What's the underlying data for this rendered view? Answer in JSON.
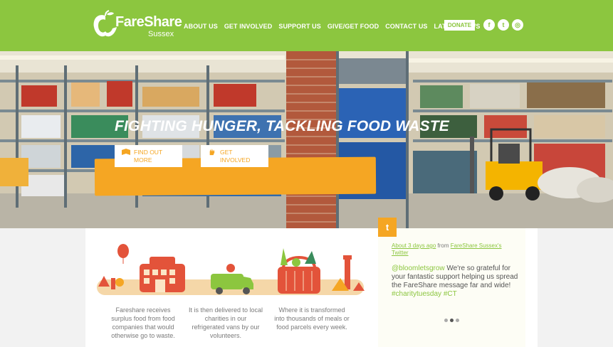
{
  "brand": {
    "name": "FareShare",
    "subname": "Sussex"
  },
  "nav": {
    "items": [
      "ABOUT US",
      "GET INVOLVED",
      "SUPPORT US",
      "GIVE/GET FOOD",
      "CONTACT US",
      "LATEST NEWS"
    ],
    "donate": "DONATE"
  },
  "social": {
    "facebook": "f",
    "twitter": "t",
    "instagram": "◎"
  },
  "hero": {
    "headline": "FIGHTING HUNGER, TACKLING FOOD WASTE",
    "buttons": [
      {
        "label": "FIND OUT MORE",
        "icon": "book-icon"
      },
      {
        "label": "GET INVOLVED",
        "icon": "hand-icon"
      }
    ]
  },
  "steps": [
    "Fareshare receives surplus food from food companies that would otherwise go to waste.",
    "It is then delivered to local charities in our refrigerated vans by our volunteers.",
    "Where it is transformed into thousands of meals or food parcels every week."
  ],
  "twitter": {
    "icon": "twitter-icon",
    "time": "About 3 days ago",
    "from": "from",
    "source": "FareShare Sussex's Twitter",
    "mention": "@bloomletsgrow",
    "text": "We're so grateful for your fantastic support helping us spread the FareShare message far and wide!",
    "hashtags": "#charitytuesday #CT"
  },
  "colors": {
    "green": "#8cc63f",
    "orange": "#f5a623",
    "red": "#e3533a"
  }
}
